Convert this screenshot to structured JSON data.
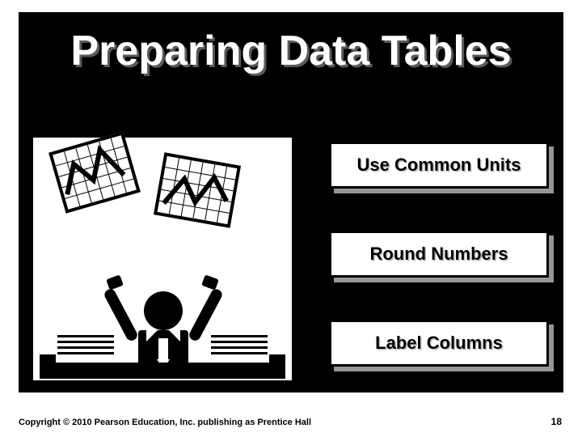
{
  "title": "Preparing Data Tables",
  "bullets": [
    "Use Common Units",
    "Round Numbers",
    "Label Columns"
  ],
  "footer": {
    "copyright": "Copyright © 2010 Pearson Education, Inc. publishing as Prentice Hall",
    "page": "18"
  },
  "image_alt": "Clip-art of a businessperson at a desk holding up two paper charts with zig-zag trend lines"
}
